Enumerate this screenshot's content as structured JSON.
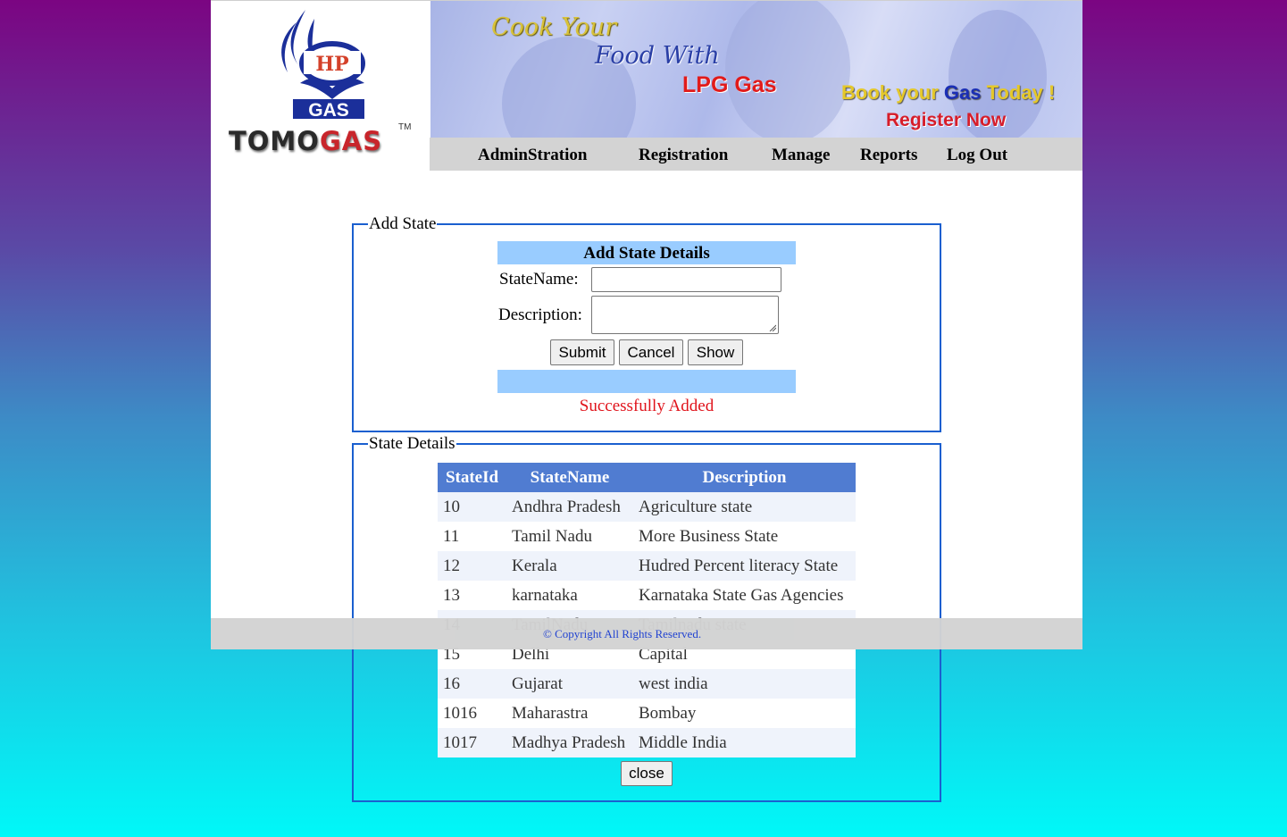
{
  "brand": {
    "logo_text": "HP GAS",
    "name_part1": "TOMO",
    "name_part2": "GAS",
    "trademark": "TM"
  },
  "banner": {
    "line1": "Cook Your",
    "line2": "Food With",
    "line3": "LPG Gas",
    "book_prefix": "Book your ",
    "book_gas": "Gas",
    "book_suffix": " Today !",
    "register": "Register Now"
  },
  "nav": [
    "AdminStration",
    "Registration",
    "Manage",
    "Reports",
    "Log Out"
  ],
  "add_state": {
    "legend": "Add State",
    "header": "Add State Details",
    "statename_label": "StateName:",
    "statename_value": "",
    "description_label": "Description:",
    "description_value": "",
    "buttons": {
      "submit": "Submit",
      "cancel": "Cancel",
      "show": "Show"
    },
    "message": "Successfully Added",
    "message_color": "#e0131b"
  },
  "state_details": {
    "legend": "State Details",
    "columns": [
      "StateId",
      "StateName",
      "Description"
    ],
    "rows": [
      [
        "10",
        "Andhra Pradesh",
        "Agriculture state"
      ],
      [
        "11",
        "Tamil Nadu",
        "More Business State"
      ],
      [
        "12",
        "Kerala",
        "Hudred Percent literacy State"
      ],
      [
        "13",
        "karnataka",
        "Karnataka State Gas Agencies"
      ],
      [
        "14",
        "TamilNadu",
        "Tamilnadu state"
      ],
      [
        "15",
        "Delhi",
        "Capital"
      ],
      [
        "16",
        "Gujarat",
        "west india"
      ],
      [
        "1016",
        "Maharastra",
        "Bombay"
      ],
      [
        "1017",
        "Madhya Pradesh",
        "Middle India"
      ]
    ],
    "close": "close"
  },
  "footer": "© Copyright All Rights Reserved.",
  "colors": {
    "header_blue": "#99ccff",
    "grid_header": "#507cd1",
    "fieldset_border": "#1a5fcf",
    "nav_bg": "#d3d3d3"
  }
}
